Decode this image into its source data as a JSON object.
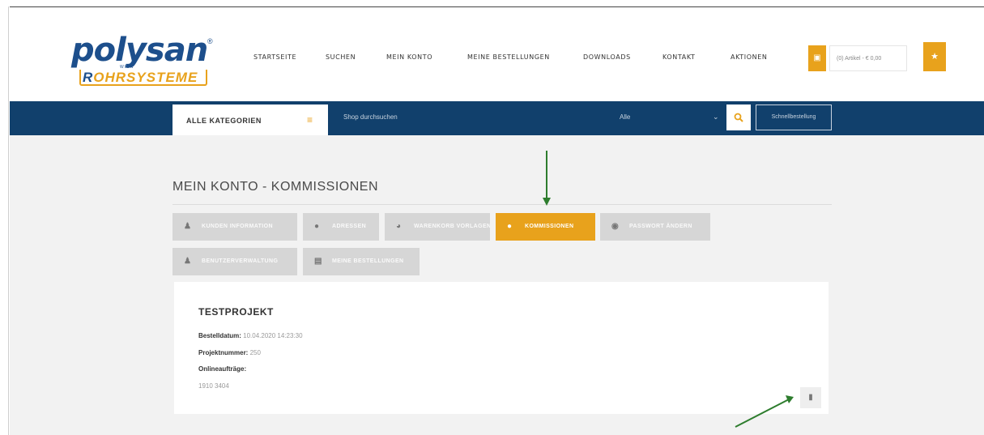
{
  "logo": {
    "main": "polysan",
    "reg": "®",
    "small": "WIEN",
    "sub_pre": "R",
    "sub_rest": "OHRSYSTEME"
  },
  "nav": [
    "STARTSEITE",
    "SUCHEN",
    "MEIN KONTO",
    "MEINE BESTELLUNGEN",
    "DOWNLOADS",
    "KONTAKT",
    "AKTIONEN"
  ],
  "cart": {
    "text": "(0) Artikel - € 0,00"
  },
  "searchbar": {
    "category_label": "ALLE KATEGORIEN",
    "placeholder": "Shop durchsuchen",
    "filter_value": "Alle",
    "quick_order": "Schnellbestellung"
  },
  "page": {
    "title": "MEIN KONTO - KOMMISSIONEN"
  },
  "tabs": [
    {
      "label": "KUNDEN INFORMATION",
      "icon": "user-icon"
    },
    {
      "label": "ADRESSEN",
      "icon": "map-pin-icon"
    },
    {
      "label": "WARENKORB VORLAGEN",
      "icon": "basket-icon"
    },
    {
      "label": "KOMMISSIONEN",
      "icon": "map-pin-icon",
      "active": true
    },
    {
      "label": "PASSWORT ÄNDERN",
      "icon": "shield-icon"
    },
    {
      "label": "BENUTZERVERWALTUNG",
      "icon": "user-icon"
    },
    {
      "label": "MEINE BESTELLUNGEN",
      "icon": "orders-icon"
    }
  ],
  "commission": {
    "title": "TESTPROJEKT",
    "order_date_label": "Bestelldatum:",
    "order_date": "10.04.2020 14:23:30",
    "project_label": "Projektnummer:",
    "project_number": "250",
    "online_label": "Onlineaufträge:",
    "online_orders": "1910 3404"
  },
  "colors": {
    "accent": "#e8a21c",
    "navbar": "#11406c",
    "annotation": "#2e7d2e"
  }
}
